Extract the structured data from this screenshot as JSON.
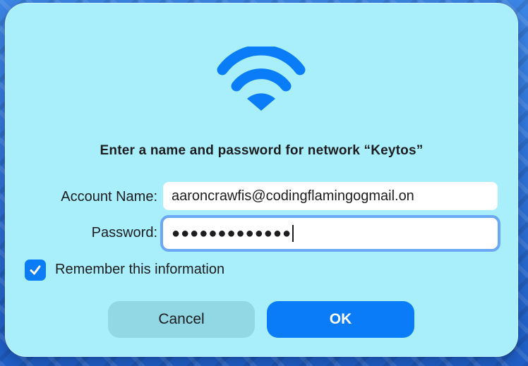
{
  "dialog": {
    "icon": "wifi-icon",
    "title": "Enter a name and password for network “Keytos”",
    "account": {
      "label": "Account Name:",
      "value": "aaroncrawfis@codingflamingogmail.on"
    },
    "password": {
      "label": "Password:",
      "value": "●●●●●●●●●●●●●"
    },
    "remember": {
      "label": "Remember this information",
      "checked": true
    },
    "buttons": {
      "cancel": "Cancel",
      "ok": "OK"
    }
  },
  "colors": {
    "dialog_bg": "#a9eefb",
    "accent": "#0a7cf8",
    "cancel_bg": "#92d7e4",
    "focus_ring": "#6aa8f5"
  }
}
